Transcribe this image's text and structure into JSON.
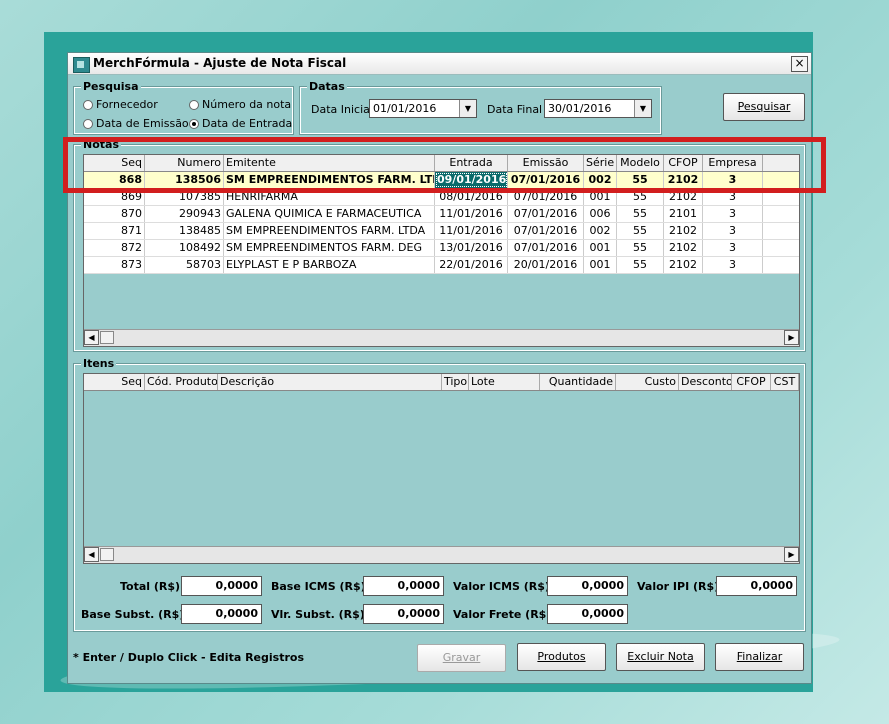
{
  "window": {
    "title": "MerchFórmula - Ajuste de Nota Fiscal",
    "close_label": "×"
  },
  "pesquisa": {
    "title": "Pesquisa",
    "options": [
      {
        "label": "Fornecedor",
        "selected": false
      },
      {
        "label": "Número da nota",
        "selected": false
      },
      {
        "label": "Data de Emissão",
        "selected": false
      },
      {
        "label": "Data de Entrada",
        "selected": true
      }
    ]
  },
  "datas": {
    "title": "Datas",
    "inicial_label": "Data Inicial",
    "inicial_value": "01/01/2016",
    "final_label": "Data Final",
    "final_value": "30/01/2016"
  },
  "pesquisar_button": "Pesquisar",
  "notas": {
    "title": "Notas",
    "columns": [
      "Seq",
      "Numero",
      "Emitente",
      "Entrada",
      "Emissão",
      "Série",
      "Modelo",
      "CFOP",
      "Empresa"
    ],
    "rows": [
      {
        "seq": "868",
        "numero": "138506",
        "emitente": "SM EMPREENDIMENTOS FARM. LTDA",
        "entrada": "09/01/2016",
        "emissao": "07/01/2016",
        "serie": "002",
        "modelo": "55",
        "cfop": "2102",
        "empresa": "3"
      },
      {
        "seq": "869",
        "numero": "107385",
        "emitente": "HENRIFARMA",
        "entrada": "08/01/2016",
        "emissao": "07/01/2016",
        "serie": "001",
        "modelo": "55",
        "cfop": "2102",
        "empresa": "3"
      },
      {
        "seq": "870",
        "numero": "290943",
        "emitente": "GALENA QUIMICA E FARMACEUTICA",
        "entrada": "11/01/2016",
        "emissao": "07/01/2016",
        "serie": "006",
        "modelo": "55",
        "cfop": "2101",
        "empresa": "3"
      },
      {
        "seq": "871",
        "numero": "138485",
        "emitente": "SM EMPREENDIMENTOS FARM. LTDA",
        "entrada": "11/01/2016",
        "emissao": "07/01/2016",
        "serie": "002",
        "modelo": "55",
        "cfop": "2102",
        "empresa": "3"
      },
      {
        "seq": "872",
        "numero": "108492",
        "emitente": "SM EMPREENDIMENTOS FARM. DEG",
        "entrada": "13/01/2016",
        "emissao": "07/01/2016",
        "serie": "001",
        "modelo": "55",
        "cfop": "2102",
        "empresa": "3"
      },
      {
        "seq": "873",
        "numero": "58703",
        "emitente": "ELYPLAST E P BARBOZA",
        "entrada": "22/01/2016",
        "emissao": "20/01/2016",
        "serie": "001",
        "modelo": "55",
        "cfop": "2102",
        "empresa": "3"
      }
    ]
  },
  "itens": {
    "title": "Itens",
    "columns": [
      "Seq",
      "Cód. Produto",
      "Descrição",
      "Tipo",
      "Lote",
      "Quantidade",
      "Custo",
      "Desconto",
      "CFOP",
      "CST"
    ]
  },
  "totals": {
    "total_label": "Total (R$)",
    "total_value": "0,0000",
    "base_icms_label": "Base ICMS (R$)",
    "base_icms_value": "0,0000",
    "valor_icms_label": "Valor ICMS (R$)",
    "valor_icms_value": "0,0000",
    "valor_ipi_label": "Valor IPI (R$)",
    "valor_ipi_value": "0,0000",
    "base_subst_label": "Base Subst. (R$)",
    "base_subst_value": "0,0000",
    "vlr_subst_label": "Vlr. Subst. (R$)",
    "vlr_subst_value": "0,0000",
    "valor_frete_label": "Valor Frete (R$)",
    "valor_frete_value": "0,0000"
  },
  "footer": {
    "note": "* Enter / Duplo Click - Edita Registros",
    "gravar": "Gravar",
    "produtos": "Produtos",
    "excluir": "Excluir Nota",
    "finalizar": "Finalizar"
  },
  "colors": {
    "window_bg": "#99cccc",
    "selected_row": "#ffffcc",
    "highlight": "#d21e1e",
    "teal_frame": "#2aa39a"
  }
}
